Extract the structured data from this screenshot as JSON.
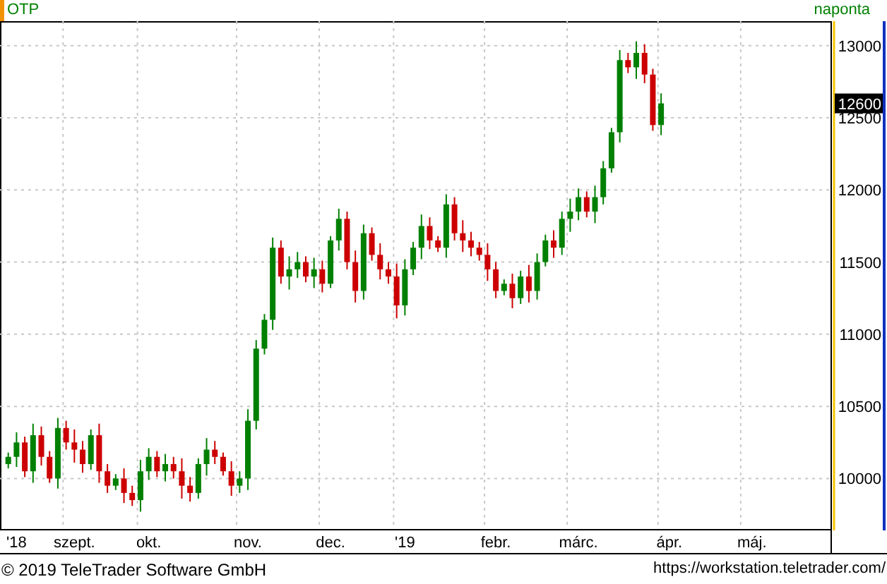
{
  "header": {
    "symbol": "OTP",
    "interval": "naponta"
  },
  "chart": {
    "last_price": "12600",
    "chart_data": {
      "type": "candlestick",
      "grid": true,
      "categories": [
        null,
        "'18",
        null,
        null,
        null,
        null,
        null,
        null,
        "szept.",
        null,
        null,
        null,
        null,
        null,
        null,
        null,
        null,
        "okt.",
        null,
        null,
        null,
        null,
        null,
        null,
        null,
        null,
        null,
        null,
        null,
        "nov.",
        null,
        null,
        null,
        null,
        null,
        null,
        null,
        null,
        null,
        "dec.",
        null,
        null,
        null,
        null,
        null,
        null,
        null,
        null,
        "'19",
        null,
        null,
        null,
        null,
        null,
        null,
        null,
        null,
        null,
        null,
        "febr.",
        null,
        null,
        null,
        null,
        null,
        null,
        null,
        null,
        null,
        "márc.",
        null,
        null,
        null,
        null,
        null,
        null,
        null,
        null,
        null,
        null,
        "ápr.",
        null,
        null,
        null,
        null,
        null,
        null,
        null,
        null,
        null,
        "máj.",
        null
      ],
      "ohlc": [
        [
          10100,
          10180,
          10070,
          10150
        ],
        [
          10150,
          10320,
          10080,
          10250
        ],
        [
          10250,
          10290,
          10010,
          10050
        ],
        [
          10050,
          10380,
          9970,
          10300
        ],
        [
          10300,
          10360,
          10090,
          10150
        ],
        [
          10150,
          10190,
          9970,
          10000
        ],
        [
          10000,
          10420,
          9930,
          10350
        ],
        [
          10350,
          10400,
          10200,
          10250
        ],
        [
          10250,
          10340,
          10110,
          10200
        ],
        [
          10200,
          10260,
          10040,
          10100
        ],
        [
          10100,
          10340,
          10060,
          10300
        ],
        [
          10300,
          10380,
          9970,
          10050
        ],
        [
          10050,
          10100,
          9900,
          9950
        ],
        [
          9950,
          10030,
          9920,
          10000
        ],
        [
          10000,
          10070,
          9830,
          9900
        ],
        [
          9900,
          9950,
          9810,
          9850
        ],
        [
          9850,
          10130,
          9770,
          10050
        ],
        [
          10050,
          10210,
          9990,
          10150
        ],
        [
          10150,
          10190,
          10010,
          10050
        ],
        [
          10050,
          10170,
          9980,
          10100
        ],
        [
          10100,
          10150,
          10000,
          10050
        ],
        [
          10050,
          10140,
          9860,
          9950
        ],
        [
          9950,
          10010,
          9840,
          9900
        ],
        [
          9900,
          10140,
          9860,
          10100
        ],
        [
          10100,
          10280,
          10020,
          10200
        ],
        [
          10200,
          10260,
          10100,
          10150
        ],
        [
          10150,
          10180,
          10020,
          10050
        ],
        [
          10050,
          10120,
          9880,
          9950
        ],
        [
          9950,
          10050,
          9900,
          10000
        ],
        [
          10000,
          10480,
          9920,
          10400
        ],
        [
          10400,
          10960,
          10340,
          10900
        ],
        [
          10900,
          11140,
          10860,
          11100
        ],
        [
          11100,
          11670,
          11030,
          11600
        ],
        [
          11600,
          11650,
          11350,
          11400
        ],
        [
          11400,
          11540,
          11310,
          11450
        ],
        [
          11450,
          11570,
          11390,
          11500
        ],
        [
          11500,
          11540,
          11360,
          11400
        ],
        [
          11400,
          11530,
          11320,
          11450
        ],
        [
          11450,
          11510,
          11290,
          11350
        ],
        [
          11350,
          11680,
          11320,
          11650
        ],
        [
          11650,
          11870,
          11580,
          11800
        ],
        [
          11800,
          11850,
          11450,
          11500
        ],
        [
          11500,
          11580,
          11220,
          11300
        ],
        [
          11300,
          11760,
          11240,
          11700
        ],
        [
          11700,
          11740,
          11510,
          11550
        ],
        [
          11550,
          11630,
          11380,
          11450
        ],
        [
          11450,
          11500,
          11350,
          11400
        ],
        [
          11400,
          11490,
          11110,
          11200
        ],
        [
          11200,
          11520,
          11130,
          11450
        ],
        [
          11450,
          11640,
          11410,
          11600
        ],
        [
          11600,
          11830,
          11520,
          11750
        ],
        [
          11750,
          11810,
          11590,
          11650
        ],
        [
          11650,
          11680,
          11570,
          11600
        ],
        [
          11600,
          11970,
          11530,
          11900
        ],
        [
          11900,
          11950,
          11650,
          11700
        ],
        [
          11700,
          11790,
          11570,
          11650
        ],
        [
          11650,
          11710,
          11540,
          11600
        ],
        [
          11600,
          11640,
          11510,
          11550
        ],
        [
          11550,
          11630,
          11370,
          11450
        ],
        [
          11450,
          11500,
          11250,
          11300
        ],
        [
          11300,
          11380,
          11270,
          11350
        ],
        [
          11350,
          11420,
          11180,
          11250
        ],
        [
          11250,
          11440,
          11210,
          11400
        ],
        [
          11400,
          11480,
          11220,
          11300
        ],
        [
          11300,
          11560,
          11240,
          11500
        ],
        [
          11500,
          11690,
          11470,
          11650
        ],
        [
          11650,
          11720,
          11530,
          11600
        ],
        [
          11600,
          11850,
          11550,
          11800
        ],
        [
          11800,
          11940,
          11710,
          11850
        ],
        [
          11850,
          12010,
          11790,
          11950
        ],
        [
          11950,
          11990,
          11810,
          11850
        ],
        [
          11850,
          12030,
          11770,
          11950
        ],
        [
          11950,
          12200,
          11900,
          12150
        ],
        [
          12150,
          12430,
          12120,
          12400
        ],
        [
          12400,
          12970,
          12330,
          12900
        ],
        [
          12900,
          12950,
          12810,
          12850
        ],
        [
          12850,
          13030,
          12770,
          12950
        ],
        [
          12950,
          13010,
          12740,
          12800
        ],
        [
          12800,
          12840,
          12410,
          12450
        ],
        [
          12450,
          12670,
          12380,
          12600
        ],
        null,
        null,
        null,
        null,
        null,
        null,
        null,
        null,
        null,
        null,
        null,
        null
      ],
      "ylim": [
        9650,
        13170
      ],
      "yticks": [
        10000,
        10500,
        11000,
        11500,
        12000,
        12500,
        13000
      ]
    }
  },
  "footer": {
    "copyright": "© 2019 TeleTrader Software GmbH",
    "url": "https://workstation.teletrader.com/"
  }
}
